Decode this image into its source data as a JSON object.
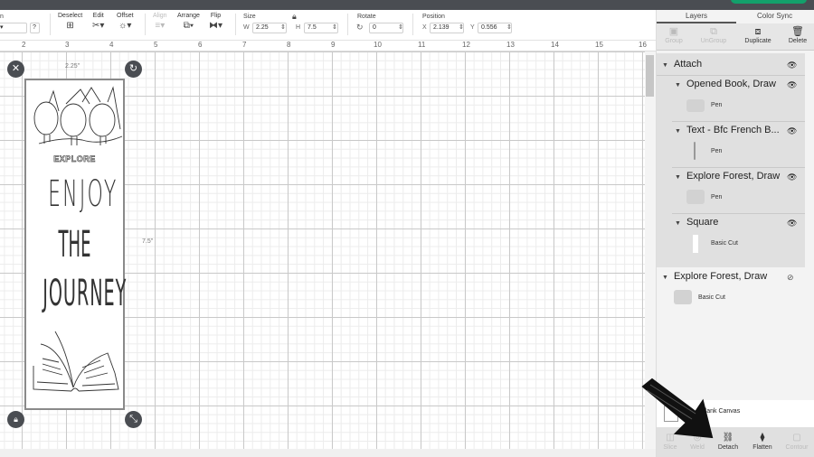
{
  "toolbar": {
    "partial_label": "n",
    "deselect": "Deselect",
    "edit": "Edit",
    "offset": "Offset",
    "align": "Align",
    "arrange": "Arrange",
    "flip": "Flip",
    "size": "Size",
    "w_label": "W",
    "w_value": "2.25",
    "h_label": "H",
    "h_value": "7.5",
    "rotate": "Rotate",
    "rotate_value": "0",
    "position": "Position",
    "x_label": "X",
    "x_value": "2.139",
    "y_label": "Y",
    "y_value": "0.556",
    "help": "?"
  },
  "ruler": [
    "2",
    "3",
    "4",
    "5",
    "6",
    "7",
    "8",
    "9",
    "10",
    "11",
    "12",
    "13",
    "14",
    "15",
    "16"
  ],
  "canvas": {
    "width_label": "2.25\"",
    "height_label": "7.5\"",
    "design_text": {
      "explore": "EXPLORE",
      "line1": "ENJOY",
      "line2": "THE",
      "line3": "JOURNEY"
    }
  },
  "panel": {
    "tabs": [
      "Layers",
      "Color Sync"
    ],
    "actions": [
      "Group",
      "UnGroup",
      "Duplicate",
      "Delete"
    ],
    "layers": {
      "attach": "Attach",
      "children": [
        {
          "name": "Opened Book, Draw",
          "op": "Pen"
        },
        {
          "name": "Text - Bfc French B...",
          "op": "Pen"
        },
        {
          "name": "Explore Forest, Draw",
          "op": "Pen"
        },
        {
          "name": "Square",
          "op": "Basic Cut"
        }
      ],
      "hidden": {
        "name": "Explore Forest, Draw",
        "op": "Basic Cut"
      }
    },
    "blank_canvas": "Blank Canvas",
    "bottom_actions": [
      "Slice",
      "Weld",
      "Detach",
      "Flatten",
      "Contour"
    ]
  }
}
